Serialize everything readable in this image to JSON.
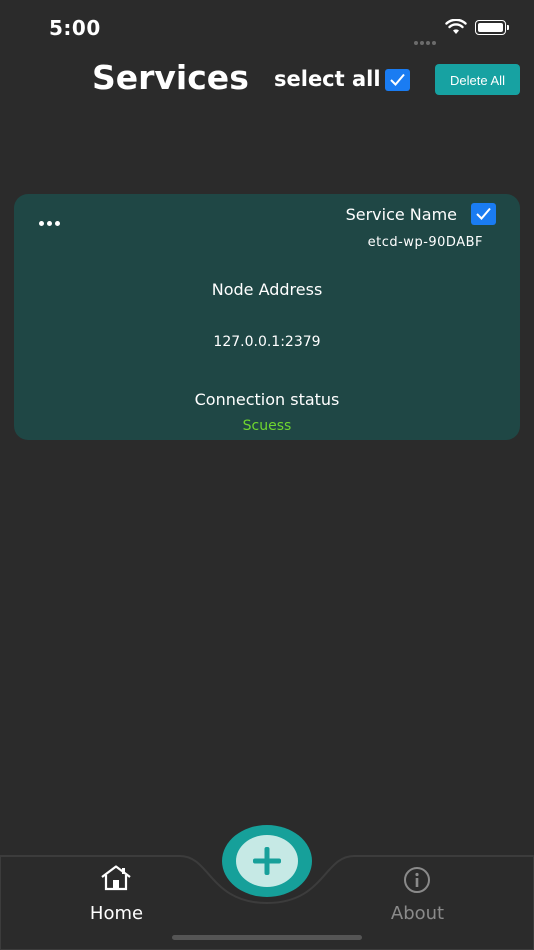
{
  "status_bar": {
    "time": "5:00"
  },
  "header": {
    "title": "Services",
    "select_all_label": "select all",
    "select_all_checked": true,
    "delete_all_label": "Delete All"
  },
  "service_card": {
    "service_name_label": "Service Name",
    "service_name": "etcd-wp-90DABF",
    "selected": true,
    "node_address_label": "Node Address",
    "node_address": "127.0.0.1:2379",
    "connection_status_label": "Connection status",
    "connection_status": "Scuess"
  },
  "tab_bar": {
    "tabs": [
      {
        "label": "Home",
        "icon": "home-icon",
        "active": true
      },
      {
        "label": "About",
        "icon": "info-icon",
        "active": false
      }
    ],
    "add_icon": "plus-icon"
  },
  "colors": {
    "background": "#2b2b2b",
    "card": "#1f4745",
    "accent": "#17a2a2",
    "checkbox": "#1a7cf2",
    "success": "#6fd62f"
  }
}
